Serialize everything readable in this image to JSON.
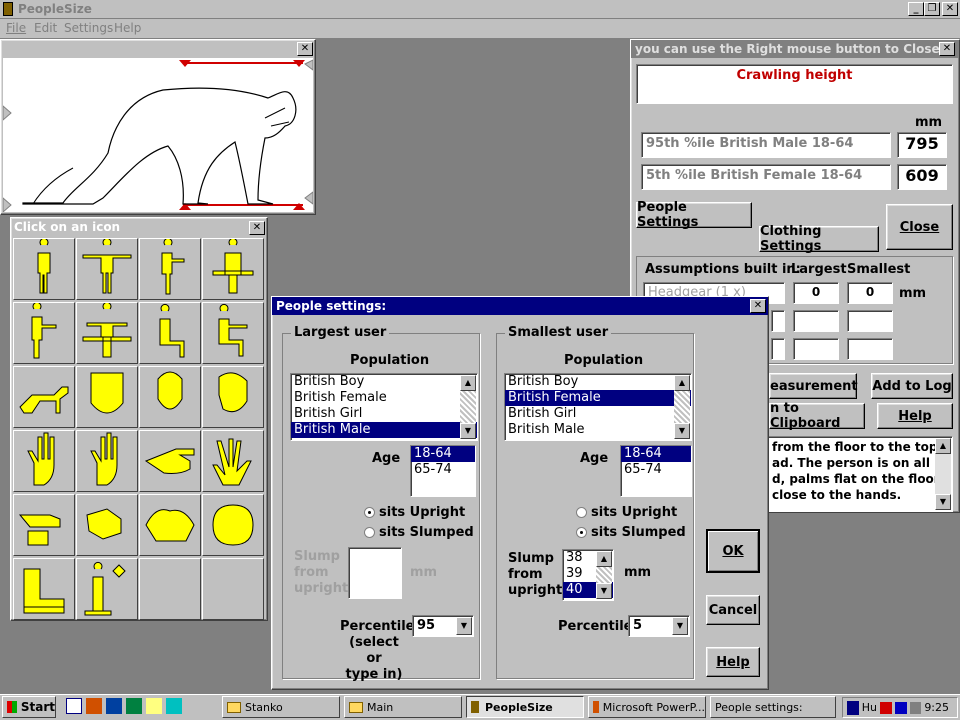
{
  "app": {
    "title": "PeopleSize",
    "menu": [
      "File",
      "Edit",
      "Settings",
      "Help"
    ]
  },
  "figure_window": {},
  "icon_palette": {
    "title": "Click on an icon"
  },
  "results": {
    "title": "you can use the Right mouse button to Close",
    "measure_name": "Crawling height",
    "mm_label": "mm",
    "row1": {
      "label": "95th %ile British Male 18-64",
      "value": "795"
    },
    "row2": {
      "label": "5th %ile British Female 18-64",
      "value": "609"
    },
    "people_settings": "People Settings",
    "clothing_settings": "Clothing Settings",
    "close": "Close",
    "assumptions_label": "Assumptions built in:",
    "largest": "Largest",
    "smallest": "Smallest",
    "headgear": "Headgear (1 x)",
    "headgear_largest": "0",
    "headgear_smallest": "0",
    "assum_mm": "mm",
    "measurement_btn": "easurement",
    "add_to_log": "Add to Log",
    "clipboard_btn": "n to Clipboard",
    "help": "Help",
    "desc_lines": [
      "from the floor to the top",
      "ad.  The person is on all",
      "d, palms flat on the floor,",
      "close to the hands."
    ]
  },
  "dialog": {
    "title": "People settings:",
    "largest_group": "Largest user",
    "smallest_group": "Smallest user",
    "population_label": "Population",
    "population_options": [
      "British Boy",
      "British Female",
      "British Girl",
      "British Male"
    ],
    "largest_population_selected": "British Male",
    "smallest_population_selected": "British Female",
    "age_label": "Age",
    "age_options": [
      "18-64",
      "65-74"
    ],
    "largest_age_selected": "18-64",
    "smallest_age_selected": "18-64",
    "sits_upright": "sits Upright",
    "sits_slumped": "sits Slumped",
    "largest_posture": "sits Upright",
    "smallest_posture": "sits Slumped",
    "slump_label": [
      "Slump",
      "from",
      "upright"
    ],
    "slump_mm": "mm",
    "slump_values": [
      "38",
      "39",
      "40"
    ],
    "slump_selected": "40",
    "percentile_label": "Percentile",
    "percentile_hint": [
      "(select or",
      "type in)"
    ],
    "largest_percentile": "95",
    "smallest_percentile": "5",
    "ok": "OK",
    "cancel": "Cancel",
    "help": "Help"
  },
  "taskbar": {
    "start": "Start",
    "tasks": [
      "Stanko",
      "Main",
      "PeopleSize",
      "Microsoft PowerP...",
      "People settings:"
    ],
    "tray_text": "Hu",
    "clock": "9:25"
  }
}
